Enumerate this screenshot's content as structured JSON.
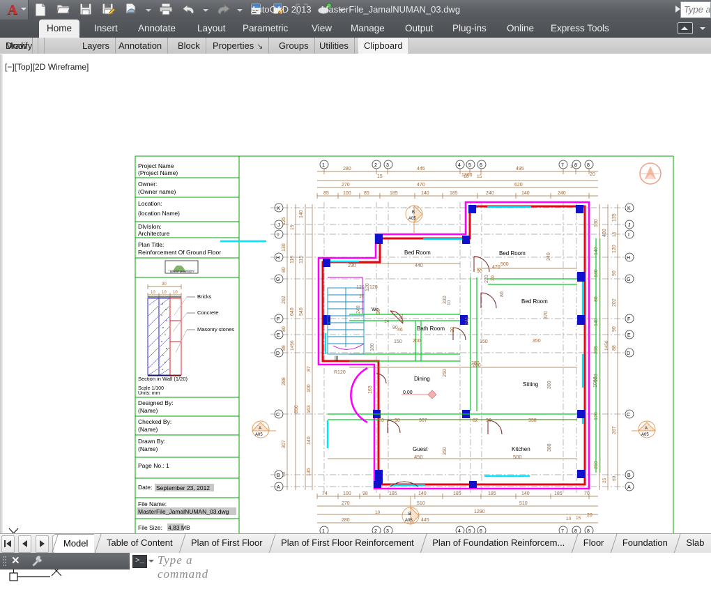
{
  "app": {
    "name": "AutoCAD 2013",
    "document": "MasterFile_JamalNUMAN_03.dwg",
    "app_menu_icon": "autocad-a-logo"
  },
  "quick_access": [
    {
      "name": "new-icon",
      "label": "New"
    },
    {
      "name": "open-icon",
      "label": "Open"
    },
    {
      "name": "save-icon",
      "label": "Save"
    },
    {
      "name": "save-as-icon",
      "label": "Save As"
    },
    {
      "name": "plot-preview-icon",
      "label": "Plot Preview"
    },
    {
      "name": "plot-icon",
      "label": "Plot"
    },
    {
      "name": "undo-icon",
      "label": "Undo"
    },
    {
      "name": "redo-icon",
      "label": "Redo"
    },
    {
      "name": "sheet-set-icon",
      "label": "Sheet Set Manager"
    },
    {
      "name": "publish-icon",
      "label": "Publish"
    },
    {
      "name": "zoom-window-icon",
      "label": "Zoom Window"
    },
    {
      "name": "render-icon",
      "label": "Render"
    }
  ],
  "search": {
    "placeholder": "Type a keyword or phrase"
  },
  "ribbon": {
    "tabs": [
      {
        "label": "Home",
        "active": true
      },
      {
        "label": "Insert",
        "active": false
      },
      {
        "label": "Annotate",
        "active": false
      },
      {
        "label": "Layout",
        "active": false
      },
      {
        "label": "Parametric",
        "active": false
      },
      {
        "label": "View",
        "active": false
      },
      {
        "label": "Manage",
        "active": false
      },
      {
        "label": "Output",
        "active": false
      },
      {
        "label": "Plug-ins",
        "active": false
      },
      {
        "label": "Online",
        "active": false
      },
      {
        "label": "Express Tools",
        "active": false
      }
    ],
    "minimize_icon": "ribbon-minimize-icon"
  },
  "panels": [
    {
      "label": "Draw"
    },
    {
      "label": "Modify"
    },
    {
      "label": "Layers"
    },
    {
      "label": "Annotation"
    },
    {
      "label": "Block"
    },
    {
      "label": "Properties",
      "expand_glyph": "↘"
    },
    {
      "label": "Groups"
    },
    {
      "label": "Utilities"
    },
    {
      "label": "Clipboard"
    }
  ],
  "viewport": {
    "label": "[−][Top][2D Wireframe]",
    "ucs": {
      "x_label": "X",
      "y_label": "Y"
    }
  },
  "title_block": {
    "rows": [
      {
        "name": "project-name",
        "label": "Project Name",
        "value": "(Project Name)"
      },
      {
        "name": "owner",
        "label": "Owner:",
        "value": "(Owner name)"
      },
      {
        "name": "location",
        "label": "Location:",
        "value": "(location Name)"
      },
      {
        "name": "division",
        "label": "DIvIsIon:",
        "value": "Architecture"
      },
      {
        "name": "plan-title",
        "label": "Plan Title:",
        "value": "Reinforcement Of Ground Floor"
      }
    ],
    "logo_caption": "BIRZEIT UNIVERSITY",
    "wall_detail": {
      "top_dim_total": "30",
      "top_dims": [
        "10",
        "10",
        "10"
      ],
      "leaders": [
        "Bricks",
        "Concrete",
        "Masonry stones"
      ],
      "caption": "Section in Wall (1/20)",
      "scale": "Scale 1/100",
      "units": "Units: mm"
    },
    "signoff": [
      {
        "name": "designed-by",
        "label": "Designed By:",
        "value": "(Name)"
      },
      {
        "name": "checked-by",
        "label": "Checked By:",
        "value": "(Name)"
      },
      {
        "name": "drawn-by",
        "label": "Drawn By:",
        "value": "(Name)"
      }
    ],
    "page_no": "Page No.: 1",
    "date": {
      "label": "Date:",
      "value": "September 23, 2012"
    },
    "file_name": {
      "label": "File Name:",
      "value": "MasterFile_JamalNUMAN_03.dwg"
    },
    "file_size": {
      "label": "File Size:",
      "value": "4,83 MB"
    }
  },
  "plan": {
    "north_symbol": "north-arrow-logo",
    "grid_numbers_top": [
      "1",
      "2",
      "3",
      "4",
      "5",
      "6",
      "7",
      "8",
      "8"
    ],
    "grid_numbers_bottom": [
      "1",
      "2",
      "3",
      "4",
      "5",
      "6",
      "7",
      "8",
      "8"
    ],
    "grid_letters_left": [
      "K",
      "J",
      "I",
      "H",
      "G",
      "F",
      "E",
      "D",
      "C",
      "B",
      "A"
    ],
    "grid_letters_right": [
      "K",
      "J",
      "I",
      "H",
      "G",
      "F",
      "E",
      "D",
      "C",
      "B",
      "A"
    ],
    "rooms": [
      {
        "label": "Bed Room"
      },
      {
        "label": "Bed Room"
      },
      {
        "label": "Bed Room"
      },
      {
        "label": "Bath Room"
      },
      {
        "label": "Wc"
      },
      {
        "label": "Dining"
      },
      {
        "label": "Sitting"
      },
      {
        "label": "Guest",
        "dim": "450"
      },
      {
        "label": "Kitchen",
        "dim": "500"
      }
    ],
    "section_markers": [
      {
        "letter": "A",
        "sheet": "A05"
      },
      {
        "letter": "A",
        "sheet": "A05"
      },
      {
        "letter": "B",
        "sheet": "A05"
      },
      {
        "letter": "B",
        "sheet": "A05"
      }
    ],
    "level_marker": "0.00",
    "dims_top_row1": [
      "280",
      "445",
      "495"
    ],
    "dims_top_row2": [
      "15",
      "1360",
      "10",
      "15",
      "20"
    ],
    "dims_top_row3": [
      "270",
      "470",
      "620"
    ],
    "dims_top_row4": [
      "85",
      "100",
      "85",
      "185",
      "140",
      "185",
      "240",
      "140",
      "240"
    ],
    "dims_bottom_row1": [
      "74",
      "100",
      "98",
      "185",
      "140",
      "185",
      "185",
      "140",
      "185",
      "70"
    ],
    "dims_bottom_row2": [
      "270",
      "510",
      "510"
    ],
    "dims_bottom_row3": [
      "280",
      "10",
      "445",
      "1290",
      "10",
      "15",
      "20"
    ],
    "dims_left": [
      "125",
      "15",
      "130",
      "80",
      "202",
      "80",
      "88",
      "288",
      "307",
      "50"
    ],
    "dims_left2": [
      "140",
      "116",
      "115",
      "640",
      "540",
      "1450",
      "87",
      "100",
      "163",
      "140",
      "135",
      "856"
    ],
    "dims_right": [
      "135",
      "15",
      "120",
      "90",
      "202",
      "90",
      "88",
      "450",
      "267",
      "60"
    ],
    "dims_right2": [
      "130",
      "140",
      "400",
      "130",
      "80",
      "140",
      "205",
      "100",
      "170",
      "210",
      "25"
    ],
    "dims_interior": [
      "230",
      "440",
      "120",
      "120",
      "10",
      "240",
      "150",
      "200",
      "150",
      "260",
      "53",
      "90",
      "307",
      "82",
      "90",
      "338",
      "350",
      "470",
      "560",
      "90",
      "80",
      "330",
      "120",
      "180",
      "46",
      "14",
      "30",
      "241",
      "370",
      "340",
      "220",
      "320"
    ]
  },
  "layout_bar": {
    "nav_buttons": [
      {
        "name": "first-layout-button",
        "icon": "first-icon"
      },
      {
        "name": "prev-layout-button",
        "icon": "prev-icon"
      },
      {
        "name": "next-layout-button",
        "icon": "next-icon"
      },
      {
        "name": "last-layout-button",
        "icon": "last-icon"
      }
    ],
    "tabs": [
      {
        "label": "Model",
        "active": true
      },
      {
        "label": "Table of Content",
        "active": false
      },
      {
        "label": "Plan of First Floor",
        "active": false
      },
      {
        "label": "Plan of First Floor Reinforcement",
        "active": false
      },
      {
        "label": "Plan of Foundation Reinforcem...",
        "active": false
      },
      {
        "label": "Floor",
        "active": false
      },
      {
        "label": "Foundation",
        "active": false
      },
      {
        "label": "Slab",
        "active": false
      }
    ]
  },
  "command_line": {
    "close_label": "✕",
    "customize_icon": "wrench-icon",
    "prompt_glyph": ">_",
    "placeholder": "Type a command"
  },
  "colors": {
    "magenta": "#ff00ff",
    "red": "#e30613",
    "cyan": "#00e5ff",
    "blue": "#1111cc",
    "green": "#00cc22",
    "brown": "#9b6b3f",
    "orange": "#f0a070",
    "gray_dash": "#999999",
    "titlebar": "#5e6166",
    "ribbon": "#4b4e53",
    "panel": "#cdcdcd"
  }
}
